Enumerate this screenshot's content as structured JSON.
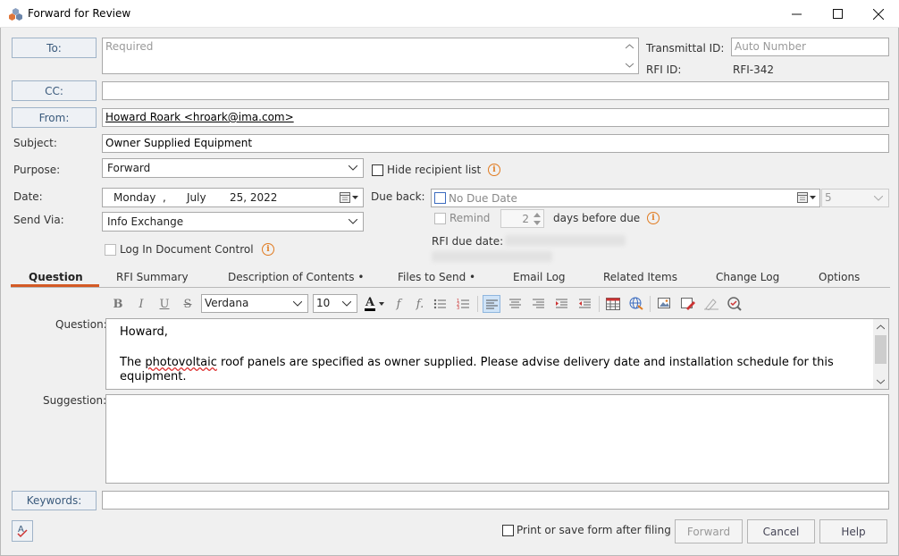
{
  "window": {
    "title": "Forward for Review"
  },
  "address": {
    "to_label": "To:",
    "to_placeholder": "Required",
    "cc_label": "CC:",
    "from_label": "From:",
    "from_value": "Howard Roark <hroark@ima.com>",
    "transmittal_label": "Transmittal ID:",
    "transmittal_placeholder": "Auto Number",
    "rfi_label": "RFI ID:",
    "rfi_value": "RFI-342"
  },
  "form": {
    "subject_label": "Subject:",
    "subject_value": "Owner Supplied Equipment",
    "purpose_label": "Purpose:",
    "purpose_value": "Forward",
    "hide_recipient_label": "Hide recipient list",
    "date_label": "Date:",
    "date_weekday": "Monday",
    "date_comma": ",",
    "date_month": "July",
    "date_day_year": "25, 2022",
    "due_back_label": "Due back:",
    "due_back_value": "No Due Date",
    "due_days": "5",
    "send_via_label": "Send Via:",
    "send_via_value": "Info Exchange",
    "remind_label": "Remind",
    "remind_days": "2",
    "days_before_label": "days before due",
    "log_label": "Log In Document Control",
    "rfi_due_label": "RFI due date:"
  },
  "tabs": [
    {
      "label": "Question"
    },
    {
      "label": "RFI Summary"
    },
    {
      "label": "Description of Contents •"
    },
    {
      "label": "Files to Send •"
    },
    {
      "label": "Email Log"
    },
    {
      "label": "Related Items"
    },
    {
      "label": "Change Log"
    },
    {
      "label": "Options"
    }
  ],
  "toolbar": {
    "font_value": "Verdana",
    "size_value": "10"
  },
  "editor": {
    "question_label": "Question:",
    "line1": "Howard,",
    "line2_before": "The ",
    "line2_misspelled": "photovoltaic",
    "line2_after": " roof panels are specified as owner supplied. Please advise delivery date and installation schedule for this",
    "line3": "equipment.",
    "suggestion_label": "Suggestion:"
  },
  "footer": {
    "keywords_label": "Keywords:",
    "print_label": "Print or save form after filing",
    "forward_label": "Forward",
    "cancel_label": "Cancel",
    "help_label": "Help"
  },
  "colors": {
    "accent": "#d45a25",
    "info": "#e07a1f",
    "link_blue": "#3a5a7c"
  }
}
